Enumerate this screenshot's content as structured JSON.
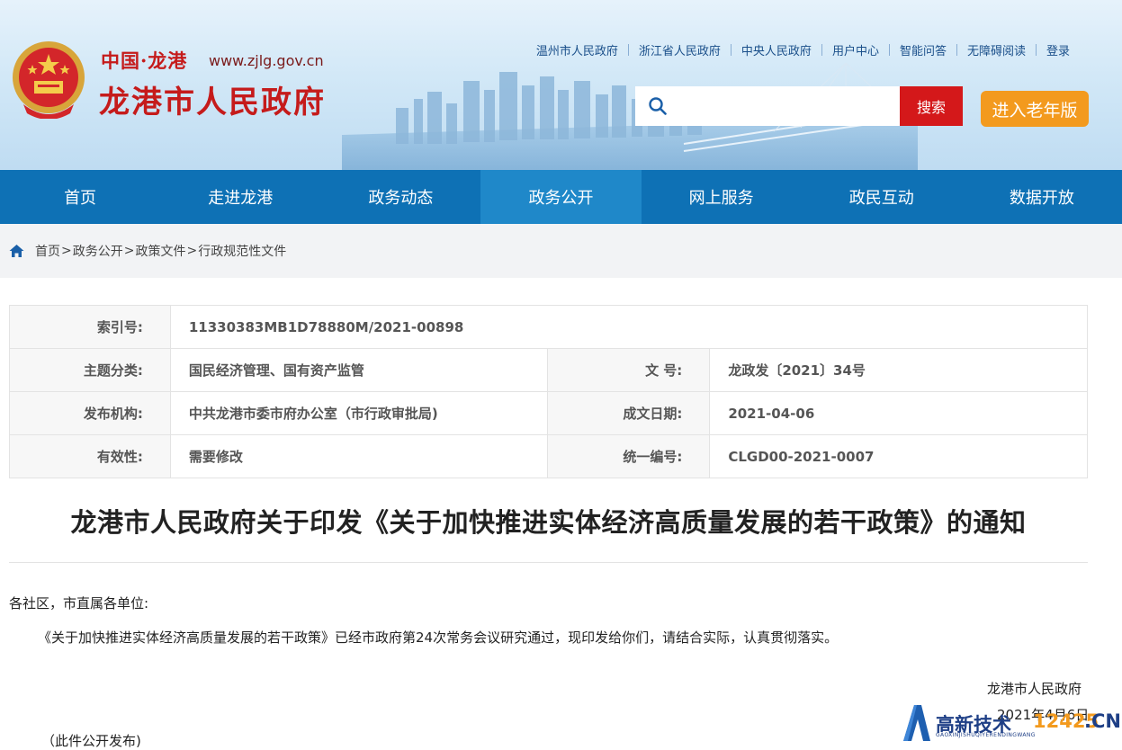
{
  "header": {
    "domain_label": "中国·龙港",
    "url": "www.zjlg.gov.cn",
    "site_name": "龙港市人民政府",
    "toplinks": [
      "温州市人民政府",
      "浙江省人民政府",
      "中央人民政府",
      "用户中心",
      "智能问答",
      "无障碍阅读",
      "登录"
    ],
    "search": {
      "placeholder": "",
      "button_label": "搜索"
    },
    "elder_button": "进入老年版"
  },
  "nav": {
    "items": [
      "首页",
      "走进龙港",
      "政务动态",
      "政务公开",
      "网上服务",
      "政民互动",
      "数据开放"
    ],
    "active": "政务公开"
  },
  "breadcrumb": [
    "首页",
    "政务公开",
    "政策文件",
    "行政规范性文件"
  ],
  "meta": {
    "index_label": "索引号:",
    "index_value": "11330383MB1D78880M/2021-00898",
    "topic_label": "主题分类:",
    "topic_value": "国民经济管理、国有资产监管",
    "docno_label": "文 号:",
    "docno_value": "龙政发〔2021〕34号",
    "org_label": "发布机构:",
    "org_value": "中共龙港市委市府办公室（市行政审批局)",
    "date_label": "成文日期:",
    "date_value": "2021-04-06",
    "validity_label": "有效性:",
    "validity_value": "需要修改",
    "unified_label": "统一编号:",
    "unified_value": "CLGD00-2021-0007"
  },
  "article": {
    "title": "龙港市人民政府关于印发《关于加快推进实体经济高质量发展的若干政策》的通知",
    "salutation": "各社区，市直属各单位:",
    "body": "《关于加快推进实体经济高质量发展的若干政策》已经市政府第24次常务会议研究通过，现印发给你们，请结合实际，认真贯彻落实。",
    "signature": "龙港市人民政府",
    "date": "2021年4月6日",
    "note": "（此件公开发布)"
  },
  "watermark": {
    "text": "高新技术",
    "number": "12425",
    "suffix": ".CN",
    "subtext": "GAOXINJISHUQIYERENDINGWANG"
  },
  "colors": {
    "nav_bg": "#0e71b5",
    "nav_active": "#1f88c9",
    "search_btn": "#d4181a",
    "elder_btn": "#f39a1e",
    "brand_red": "#c51b1b"
  },
  "icons": [
    "national-emblem",
    "search-icon",
    "home-icon"
  ]
}
